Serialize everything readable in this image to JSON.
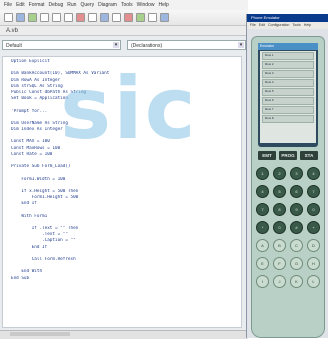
{
  "ide": {
    "menu_items": [
      "File",
      "Edit",
      "Format",
      "Debug",
      "Run",
      "Query",
      "Diagram",
      "Tools",
      "Window",
      "Help"
    ],
    "tab_label": "A.vb",
    "selector_left": "Default",
    "selector_right": "(Declarations)",
    "code_lines": [
      "Option Explicit",
      "",
      "Dim BankAccount(10), SUMMAX As Variant",
      "Dim RowA As Integer",
      "Dim strSQL As String",
      "Public Const dbPath As String",
      "Set Book = Application",
      "",
      "'Prompt for...",
      "",
      "Dim UserName As String",
      "Dim Index As Integer",
      "",
      "Const MAX = 100",
      "Const MaxRows = 100",
      "Const Rate = 100",
      "",
      "Private Sub Form_Load()",
      "",
      "    Form1.Width = 100",
      "",
      "    If x.Height = 500 Then",
      "        Form1.Height = 500",
      "    End If",
      "",
      "    With Form1",
      "",
      "        If .Text = \"\" Then",
      "            .Text = \"\"",
      "            .Caption = \"\"",
      "        End If",
      "",
      "        Call Form.Refresh",
      "",
      "    End With",
      "End Sub"
    ]
  },
  "watermark_text": "sic",
  "phone": {
    "window_title": "Phone Emulator",
    "menu_items": [
      "File",
      "Edit",
      "Configuration",
      "Tools",
      "Help"
    ],
    "screen_title": "Emulator",
    "screen_rows": [
      "Row 1",
      "Row 2",
      "Row 3",
      "Row 4",
      "Row 5",
      "Row 6",
      "Row 7",
      "Row 8"
    ],
    "softkeys": [
      "EMT",
      "PROG",
      "STA"
    ],
    "keypad": [
      [
        "1",
        "2",
        "3",
        "4"
      ],
      [
        "4",
        "5",
        "6",
        "7"
      ],
      [
        "7",
        "8",
        "9",
        "0"
      ],
      [
        "*",
        "0",
        "#",
        "+"
      ],
      [
        "A",
        "B",
        "C",
        "D"
      ],
      [
        "E",
        "F",
        "G",
        "H"
      ],
      [
        "I",
        "J",
        "K",
        "L"
      ]
    ]
  },
  "colors": {
    "watermark": "#87c3e4",
    "code_text": "#1f3b8c",
    "phone_body": "#b9d0c6",
    "phone_keys": "#3a5a49",
    "title_bar": "#0a3a8c"
  }
}
